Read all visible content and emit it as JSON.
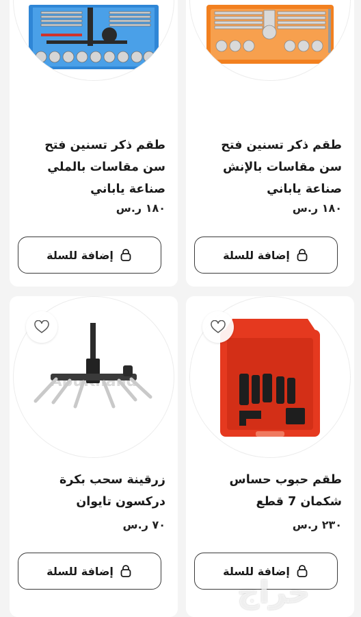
{
  "products": [
    {
      "title": "طقم ذكر تسنين فتح سن مقاسات بالإنش صناعة ياباني",
      "price": "١٨٠ ر.س",
      "cta": "إضافة للسلة",
      "image": "orange-tap-and-die-set",
      "favorite_icon": false
    },
    {
      "title": "طقم ذكر تسنين فتح سن مقاسات بالملي صناعة ياباني",
      "price": "١٨٠ ر.س",
      "cta": "إضافة للسلة",
      "image": "blue-tap-and-die-set",
      "favorite_icon": false
    },
    {
      "title": "طقم حبوب حساس شكمان 7 قطع",
      "price": "٢٣٠ ر.س",
      "cta": "إضافة للسلة",
      "image": "red-socket-set-case",
      "favorite_icon": true
    },
    {
      "title": "زرقينة سحب بكرة دركسون تايوان",
      "price": "٧٠ ر.س",
      "cta": "إضافة للسلة",
      "image": "steering-wheel-puller",
      "favorite_icon": true
    }
  ],
  "watermark": "حراج",
  "colors": {
    "accent_orange": "#f2801f",
    "accent_blue": "#2f86d6",
    "case_red": "#e5391f",
    "border": "#3a3a3a"
  }
}
